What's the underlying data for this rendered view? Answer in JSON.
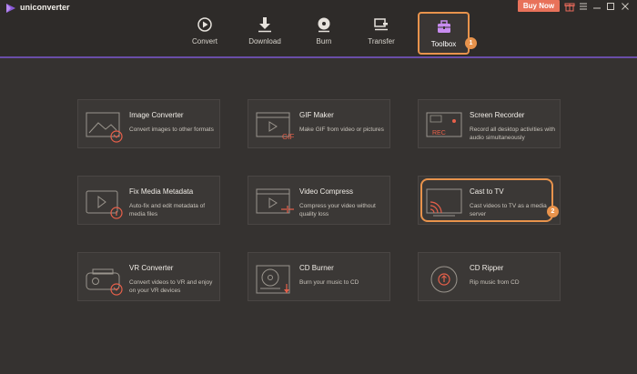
{
  "app": {
    "title": "uniconverter"
  },
  "header": {
    "buy_now": "Buy Now",
    "nav": [
      {
        "label": "Convert",
        "icon": "convert-icon"
      },
      {
        "label": "Download",
        "icon": "download-icon"
      },
      {
        "label": "Burn",
        "icon": "burn-icon"
      },
      {
        "label": "Transfer",
        "icon": "transfer-icon"
      },
      {
        "label": "Toolbox",
        "icon": "toolbox-icon",
        "active": true
      }
    ]
  },
  "annotations": {
    "badge1": "1",
    "badge2": "2"
  },
  "tools": [
    {
      "title": "Image Converter",
      "desc": "Convert images to other formats"
    },
    {
      "title": "GIF Maker",
      "desc": "Make GIF from video or pictures"
    },
    {
      "title": "Screen Recorder",
      "desc": "Record all desktop activities with audio simultaneously"
    },
    {
      "title": "Fix Media Metadata",
      "desc": "Auto-fix and edit metadata of media files"
    },
    {
      "title": "Video Compress",
      "desc": "Compress your video without quality loss"
    },
    {
      "title": "Cast to TV",
      "desc": "Cast videos to TV as a media server"
    },
    {
      "title": "VR Converter",
      "desc": "Convert videos to VR and enjoy on your VR devices"
    },
    {
      "title": "CD Burner",
      "desc": "Burn your music to CD"
    },
    {
      "title": "CD Ripper",
      "desc": "Rip music from CD"
    }
  ],
  "icon_labels": {
    "gif": "GIF",
    "rec": "REC"
  },
  "colors": {
    "accent": "#e8934c",
    "highlight_line": "#6a4ea8",
    "buy_now": "#e8725a",
    "icon_red": "#e8604a"
  }
}
